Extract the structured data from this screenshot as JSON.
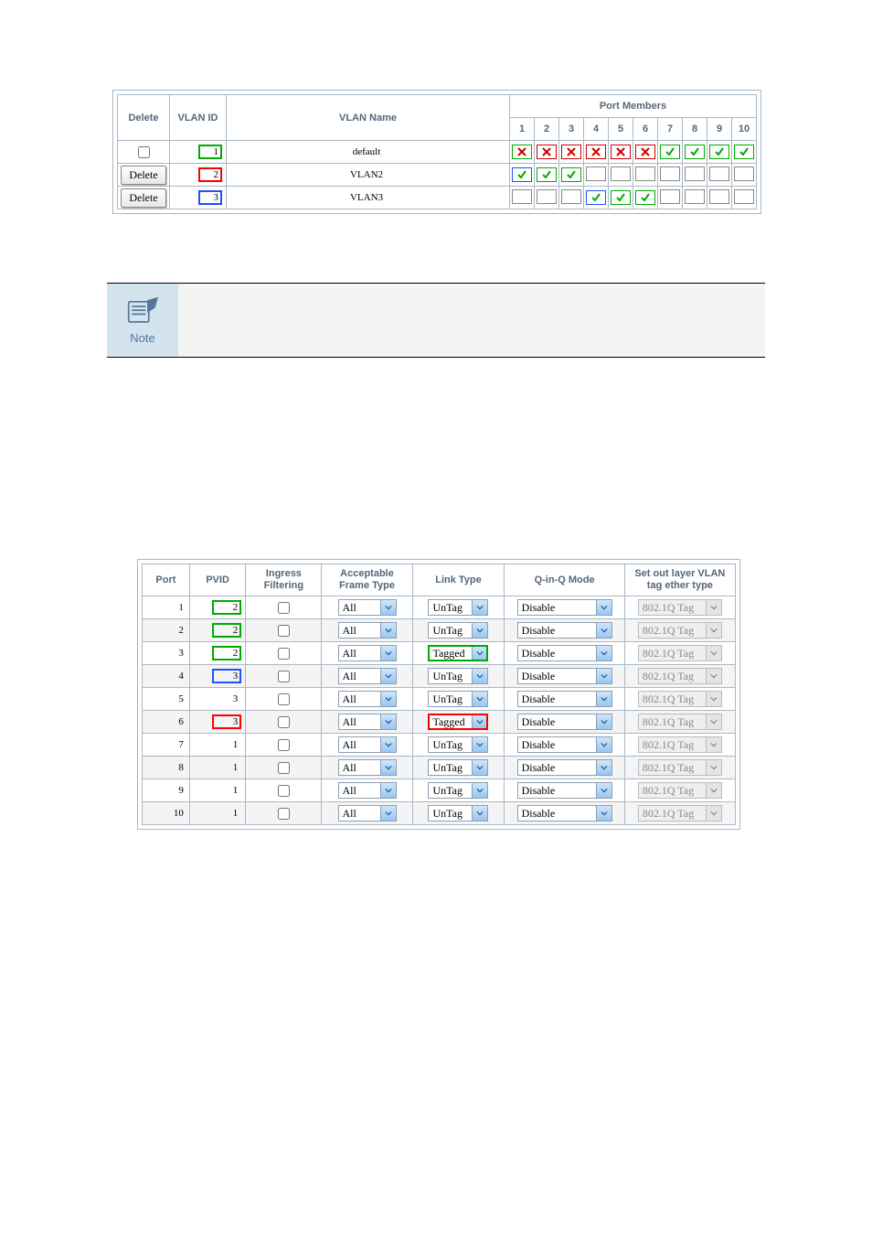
{
  "vlan_table": {
    "headers": {
      "delete": "Delete",
      "vlan_id": "VLAN ID",
      "vlan_name": "VLAN Name",
      "port_members": "Port Members"
    },
    "port_numbers": [
      "1",
      "2",
      "3",
      "4",
      "5",
      "6",
      "7",
      "8",
      "9",
      "10"
    ],
    "rows": [
      {
        "delete_mode": "checkbox",
        "delete_label": "",
        "vlan_id": "1",
        "vlan_id_highlight": "green",
        "vlan_name": "default",
        "members": [
          {
            "state": "x",
            "hl": "green"
          },
          {
            "state": "x",
            "hl": "red"
          },
          {
            "state": "x",
            "hl": "red"
          },
          {
            "state": "x",
            "hl": "red"
          },
          {
            "state": "x",
            "hl": "red"
          },
          {
            "state": "x",
            "hl": "red"
          },
          {
            "state": "chk",
            "hl": "green"
          },
          {
            "state": "chk",
            "hl": "green"
          },
          {
            "state": "chk",
            "hl": "green"
          },
          {
            "state": "chk",
            "hl": "green"
          }
        ]
      },
      {
        "delete_mode": "button",
        "delete_label": "Delete",
        "vlan_id": "2",
        "vlan_id_highlight": "red",
        "vlan_name": "VLAN2",
        "members": [
          {
            "state": "chk",
            "hl": "blue"
          },
          {
            "state": "chk",
            "hl": "green"
          },
          {
            "state": "chk",
            "hl": "green"
          },
          {
            "state": "blank",
            "hl": ""
          },
          {
            "state": "blank",
            "hl": ""
          },
          {
            "state": "blank",
            "hl": ""
          },
          {
            "state": "blank",
            "hl": ""
          },
          {
            "state": "blank",
            "hl": ""
          },
          {
            "state": "blank",
            "hl": ""
          },
          {
            "state": "blank",
            "hl": ""
          }
        ]
      },
      {
        "delete_mode": "button",
        "delete_label": "Delete",
        "vlan_id": "3",
        "vlan_id_highlight": "blue",
        "vlan_name": "VLAN3",
        "members": [
          {
            "state": "blank",
            "hl": ""
          },
          {
            "state": "blank",
            "hl": ""
          },
          {
            "state": "blank",
            "hl": ""
          },
          {
            "state": "chk",
            "hl": "blue"
          },
          {
            "state": "chk",
            "hl": "green"
          },
          {
            "state": "chk",
            "hl": "green"
          },
          {
            "state": "blank",
            "hl": ""
          },
          {
            "state": "blank",
            "hl": ""
          },
          {
            "state": "blank",
            "hl": ""
          },
          {
            "state": "blank",
            "hl": ""
          }
        ]
      }
    ]
  },
  "note_label": "Note",
  "port_config": {
    "headers": {
      "port": "Port",
      "pvid": "PVID",
      "ingress": "Ingress Filtering",
      "aft": "Acceptable Frame Type",
      "ltype": "Link Type",
      "qinq": "Q-in-Q Mode",
      "ethertype": "Set out layer VLAN tag ether type"
    },
    "rows": [
      {
        "port": "1",
        "pvid": "2",
        "pvid_hl": "green",
        "ingress": false,
        "aft": "All",
        "ltype": "UnTag",
        "ltype_hl": "",
        "qinq": "Disable",
        "eth": "802.1Q Tag",
        "eth_disabled": true
      },
      {
        "port": "2",
        "pvid": "2",
        "pvid_hl": "green",
        "ingress": false,
        "aft": "All",
        "ltype": "UnTag",
        "ltype_hl": "",
        "qinq": "Disable",
        "eth": "802.1Q Tag",
        "eth_disabled": true
      },
      {
        "port": "3",
        "pvid": "2",
        "pvid_hl": "green",
        "ingress": false,
        "aft": "All",
        "ltype": "Tagged",
        "ltype_hl": "green",
        "qinq": "Disable",
        "eth": "802.1Q Tag",
        "eth_disabled": true
      },
      {
        "port": "4",
        "pvid": "3",
        "pvid_hl": "blue",
        "ingress": false,
        "aft": "All",
        "ltype": "UnTag",
        "ltype_hl": "",
        "qinq": "Disable",
        "eth": "802.1Q Tag",
        "eth_disabled": true
      },
      {
        "port": "5",
        "pvid": "3",
        "pvid_hl": "",
        "ingress": false,
        "aft": "All",
        "ltype": "UnTag",
        "ltype_hl": "",
        "qinq": "Disable",
        "eth": "802.1Q Tag",
        "eth_disabled": true
      },
      {
        "port": "6",
        "pvid": "3",
        "pvid_hl": "red",
        "ingress": false,
        "aft": "All",
        "ltype": "Tagged",
        "ltype_hl": "red",
        "qinq": "Disable",
        "eth": "802.1Q Tag",
        "eth_disabled": true
      },
      {
        "port": "7",
        "pvid": "1",
        "pvid_hl": "",
        "ingress": false,
        "aft": "All",
        "ltype": "UnTag",
        "ltype_hl": "",
        "qinq": "Disable",
        "eth": "802.1Q Tag",
        "eth_disabled": true
      },
      {
        "port": "8",
        "pvid": "1",
        "pvid_hl": "",
        "ingress": false,
        "aft": "All",
        "ltype": "UnTag",
        "ltype_hl": "",
        "qinq": "Disable",
        "eth": "802.1Q Tag",
        "eth_disabled": true
      },
      {
        "port": "9",
        "pvid": "1",
        "pvid_hl": "",
        "ingress": false,
        "aft": "All",
        "ltype": "UnTag",
        "ltype_hl": "",
        "qinq": "Disable",
        "eth": "802.1Q Tag",
        "eth_disabled": true
      },
      {
        "port": "10",
        "pvid": "1",
        "pvid_hl": "",
        "ingress": false,
        "aft": "All",
        "ltype": "UnTag",
        "ltype_hl": "",
        "qinq": "Disable",
        "eth": "802.1Q Tag",
        "eth_disabled": true
      }
    ]
  }
}
